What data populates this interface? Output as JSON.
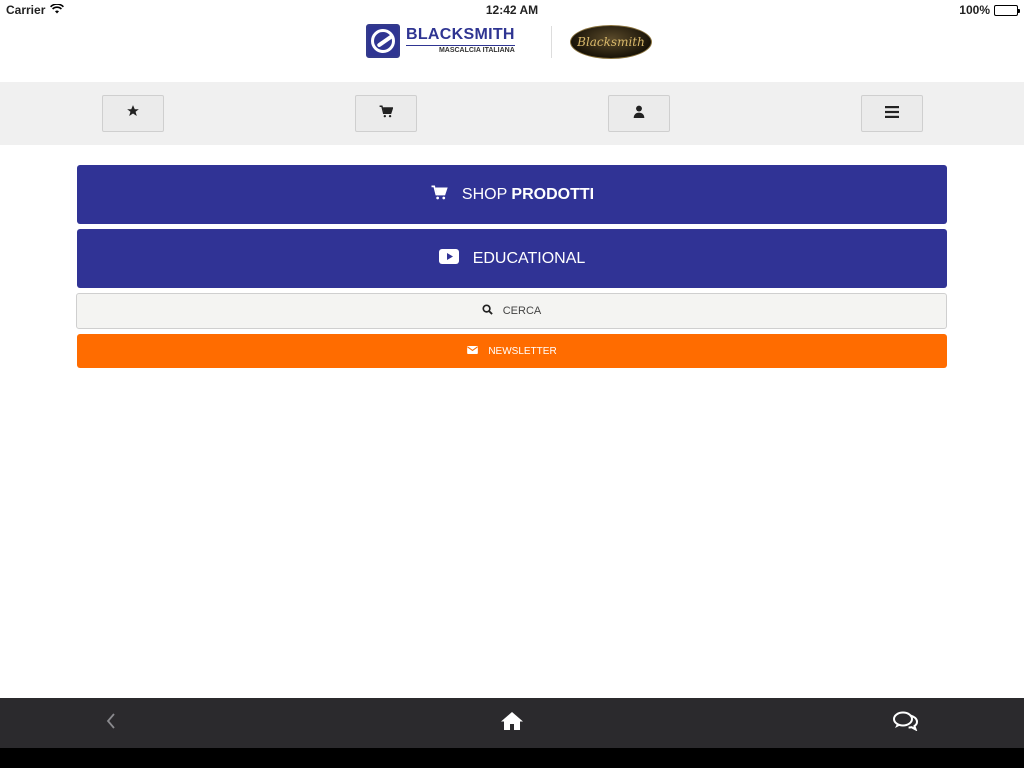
{
  "status_bar": {
    "carrier": "Carrier",
    "time": "12:42 AM",
    "battery": "100%",
    "icons": [
      "wifi-icon",
      "battery-icon"
    ]
  },
  "header": {
    "logo_brand": "BLACKSMITH",
    "logo_subtitle": "MASCALCIA ITALIANA",
    "logo_secondary": "Blacksmith"
  },
  "toolbar": {
    "buttons": [
      {
        "icon": "star-icon"
      },
      {
        "icon": "cart-icon"
      },
      {
        "icon": "user-icon"
      },
      {
        "icon": "menu-icon"
      }
    ]
  },
  "main": {
    "shop": {
      "label_light": "SHOP",
      "label_bold": "PRODOTTI",
      "icon": "cart-icon"
    },
    "educational": {
      "label": "EDUCATIONAL",
      "icon": "play-icon"
    },
    "search": {
      "label": "CERCA",
      "icon": "search-icon"
    },
    "newsletter": {
      "label": "NEWSLETTER",
      "icon": "envelope-icon"
    }
  },
  "bottom_bar": {
    "icons": [
      "back-icon",
      "home-icon",
      "chat-icon"
    ]
  },
  "colors": {
    "primary": "#303395",
    "accent": "#ff6c00",
    "toolbar_bg": "#f0f0f0",
    "bottom_bar_bg": "#2b2a2d"
  }
}
